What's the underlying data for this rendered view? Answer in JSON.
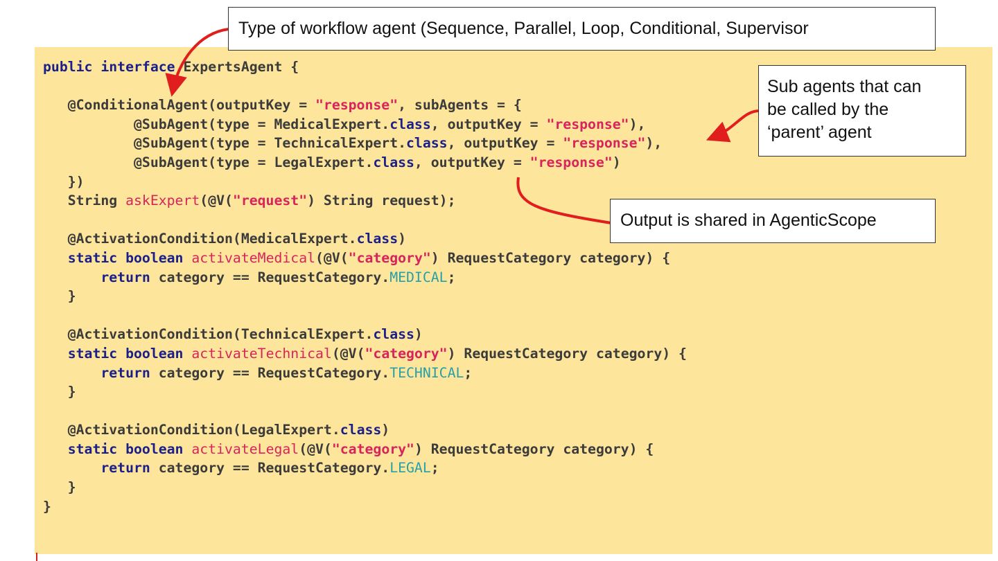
{
  "callouts": {
    "workflow_type": "Type of workflow agent (Sequence, Parallel, Loop, Conditional, Supervisor",
    "sub_agents_line1": "Sub agents that can",
    "sub_agents_line2": "be called by the",
    "sub_agents_line3": "‘parent’ agent",
    "output_shared": "Output is shared in AgenticScope"
  },
  "code": {
    "l1": {
      "a": "public interface",
      "b": " ExpertsAgent {"
    },
    "l3": {
      "a": "   @ConditionalAgent(outputKey = ",
      "b": "\"response\"",
      "c": ", subAgents = {"
    },
    "l4": {
      "a": "           @SubAgent(type = MedicalExpert.",
      "b": "class",
      "c": ", outputKey = ",
      "d": "\"response\"",
      "e": "),"
    },
    "l5": {
      "a": "           @SubAgent(type = TechnicalExpert.",
      "b": "class",
      "c": ", outputKey = ",
      "d": "\"response\"",
      "e": "),"
    },
    "l6": {
      "a": "           @SubAgent(type = LegalExpert.",
      "b": "class",
      "c": ", outputKey = ",
      "d": "\"response\"",
      "e": ")"
    },
    "l7": {
      "a": "   })"
    },
    "l8": {
      "a": "   String ",
      "b": "askExpert",
      "c": "(@V(",
      "d": "\"request\"",
      "e": ") String request);"
    },
    "l10": {
      "a": "   @ActivationCondition(MedicalExpert.",
      "b": "class",
      "c": ")"
    },
    "l11": {
      "a": "   static boolean",
      "b": " ",
      "c": "activateMedical",
      "d": "(@V(",
      "e": "\"category\"",
      "f": ") RequestCategory category) {"
    },
    "l12": {
      "a": "       return",
      "b": " category == RequestCategory.",
      "c": "MEDICAL",
      "d": ";"
    },
    "l13": {
      "a": "   }"
    },
    "l15": {
      "a": "   @ActivationCondition(TechnicalExpert.",
      "b": "class",
      "c": ")"
    },
    "l16": {
      "a": "   static boolean",
      "b": " ",
      "c": "activateTechnical",
      "d": "(@V(",
      "e": "\"category\"",
      "f": ") RequestCategory category) {"
    },
    "l17": {
      "a": "       return",
      "b": " category == RequestCategory.",
      "c": "TECHNICAL",
      "d": ";"
    },
    "l18": {
      "a": "   }"
    },
    "l20": {
      "a": "   @ActivationCondition(LegalExpert.",
      "b": "class",
      "c": ")"
    },
    "l21": {
      "a": "   static boolean",
      "b": " ",
      "c": "activateLegal",
      "d": "(@V(",
      "e": "\"category\"",
      "f": ") RequestCategory category) {"
    },
    "l22": {
      "a": "       return",
      "b": " category == RequestCategory.",
      "c": "LEGAL",
      "d": ";"
    },
    "l23": {
      "a": "   }"
    },
    "l24": {
      "a": "}"
    }
  },
  "colors": {
    "panel_background": "#fde59b",
    "keyword": "#1b1f8a",
    "string": "#d8245c",
    "constant": "#25a0a8",
    "arrow": "#e01e1e"
  }
}
